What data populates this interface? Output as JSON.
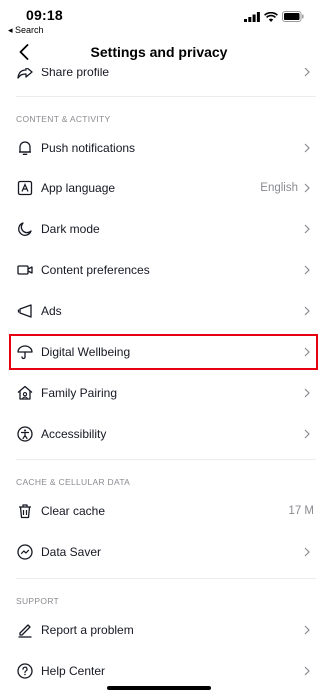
{
  "status_bar": {
    "time": "09:18",
    "back_app": "◂ Search"
  },
  "header": {
    "title": "Settings and privacy"
  },
  "partial_row": {
    "label": "Share profile"
  },
  "sections": {
    "content_activity": "CONTENT & ACTIVITY",
    "cache": "CACHE & CELLULAR DATA",
    "support": "SUPPORT"
  },
  "rows": {
    "push_notifications": {
      "label": "Push notifications",
      "icon": "bell-icon"
    },
    "app_language": {
      "label": "App language",
      "value": "English",
      "icon": "language-icon"
    },
    "dark_mode": {
      "label": "Dark mode",
      "icon": "moon-icon"
    },
    "content_preferences": {
      "label": "Content preferences",
      "icon": "video-icon"
    },
    "ads": {
      "label": "Ads",
      "icon": "megaphone-icon"
    },
    "digital_wellbeing": {
      "label": "Digital Wellbeing",
      "icon": "umbrella-icon"
    },
    "family_pairing": {
      "label": "Family Pairing",
      "icon": "home-icon"
    },
    "accessibility": {
      "label": "Accessibility",
      "icon": "accessibility-icon"
    },
    "clear_cache": {
      "label": "Clear cache",
      "value": "17 M",
      "icon": "trash-icon"
    },
    "data_saver": {
      "label": "Data Saver",
      "icon": "data-saver-icon"
    },
    "report_problem": {
      "label": "Report a problem",
      "icon": "pencil-icon"
    },
    "help_center": {
      "label": "Help Center",
      "icon": "help-icon"
    }
  },
  "colors": {
    "highlight": "#e60012",
    "secondary_text": "#8a8b91",
    "primary_text": "#161823"
  }
}
